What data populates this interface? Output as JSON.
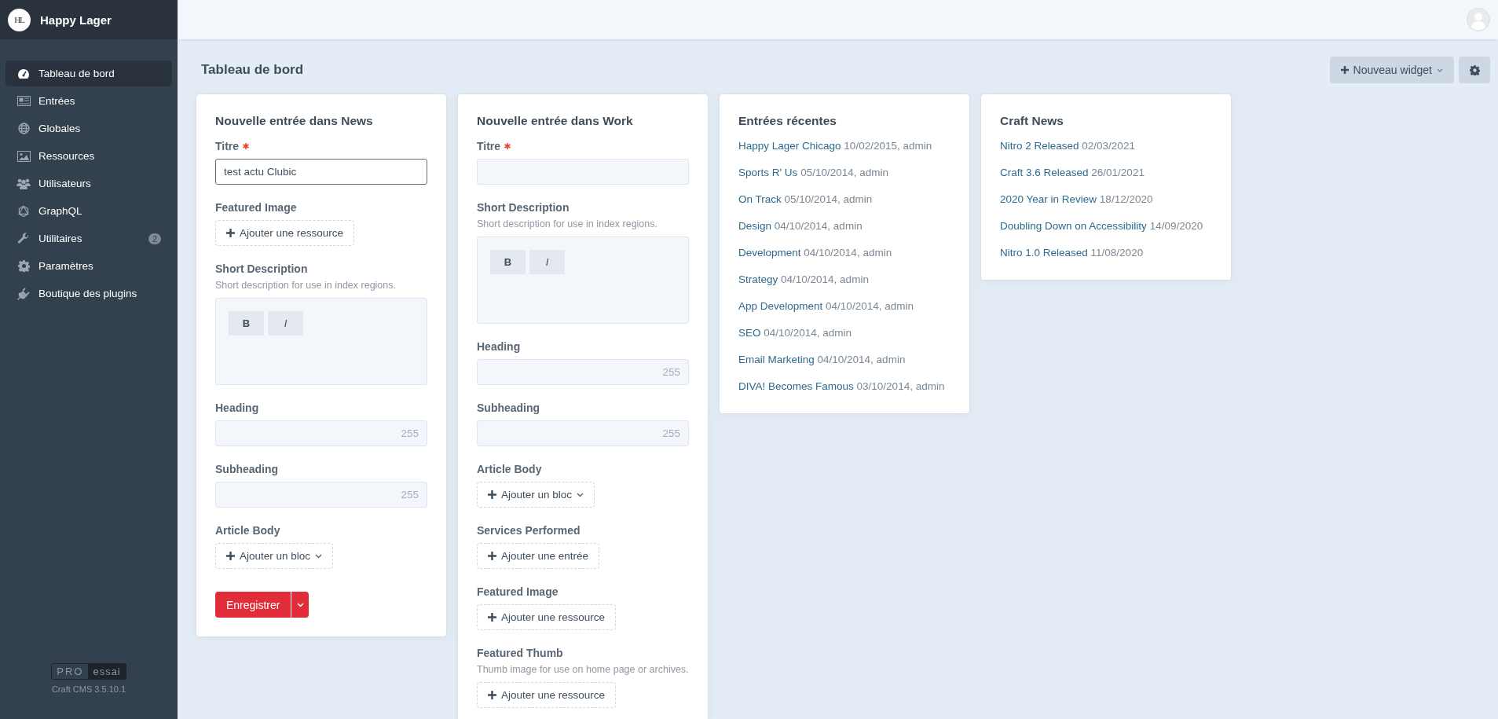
{
  "sidebar": {
    "logo_text": "HL",
    "site_name": "Happy Lager",
    "items": [
      {
        "label": "Tableau de bord",
        "selected": true
      },
      {
        "label": "Entrées",
        "selected": false
      },
      {
        "label": "Globales",
        "selected": false
      },
      {
        "label": "Ressources",
        "selected": false
      },
      {
        "label": "Utilisateurs",
        "selected": false
      },
      {
        "label": "GraphQL",
        "selected": false
      },
      {
        "label": "Utilitaires",
        "selected": false,
        "badge": "2"
      },
      {
        "label": "Paramètres",
        "selected": false
      },
      {
        "label": "Boutique des plugins",
        "selected": false
      }
    ],
    "edition": {
      "name": "PRO",
      "status": "essai"
    },
    "version": "Craft CMS 3.5.10.1"
  },
  "page_title": "Tableau de bord",
  "toolbar": {
    "new_widget": "Nouveau widget"
  },
  "widgets": [
    {
      "kind": "form",
      "title": "Nouvelle entrée dans News",
      "fields": [
        {
          "kind": "text",
          "label": "Titre",
          "required": true,
          "value": "test actu Clubic",
          "focused": true
        },
        {
          "kind": "button",
          "label": "Featured Image",
          "required": false,
          "button": "Ajouter une ressource",
          "caret": false
        },
        {
          "kind": "richtext",
          "label": "Short Description",
          "required": false,
          "instructions": "Short description for use in index regions.",
          "toolbar": [
            "B",
            "I"
          ]
        },
        {
          "kind": "text",
          "label": "Heading",
          "required": false,
          "counter": "255",
          "focused": false
        },
        {
          "kind": "text",
          "label": "Subheading",
          "required": false,
          "counter": "255",
          "focused": false
        },
        {
          "kind": "button",
          "label": "Article Body",
          "required": false,
          "button": "Ajouter un bloc",
          "caret": true
        }
      ],
      "save": "Enregistrer"
    },
    {
      "kind": "form",
      "title": "Nouvelle entrée dans Work",
      "fields": [
        {
          "kind": "text",
          "label": "Titre",
          "required": true,
          "focused": false
        },
        {
          "kind": "richtext",
          "label": "Short Description",
          "required": false,
          "instructions": "Short description for use in index regions.",
          "toolbar": [
            "B",
            "I"
          ]
        },
        {
          "kind": "text",
          "label": "Heading",
          "required": false,
          "counter": "255",
          "focused": false
        },
        {
          "kind": "text",
          "label": "Subheading",
          "required": false,
          "counter": "255",
          "focused": false
        },
        {
          "kind": "button",
          "label": "Article Body",
          "required": false,
          "button": "Ajouter un bloc",
          "caret": true
        },
        {
          "kind": "button",
          "label": "Services Performed",
          "required": false,
          "button": "Ajouter une entrée",
          "caret": false
        },
        {
          "kind": "button",
          "label": "Featured Image",
          "required": false,
          "button": "Ajouter une ressource",
          "caret": false
        },
        {
          "kind": "button",
          "label": "Featured Thumb",
          "required": false,
          "instructions": "Thumb image for use on home page or archives.",
          "button": "Ajouter une ressource",
          "caret": false
        }
      ]
    },
    {
      "kind": "list",
      "title": "Entrées récentes",
      "items": [
        {
          "link": "Happy Lager Chicago",
          "meta": "10/02/2015, admin"
        },
        {
          "link": "Sports R' Us",
          "meta": "05/10/2014, admin"
        },
        {
          "link": "On Track",
          "meta": "05/10/2014, admin"
        },
        {
          "link": "Design",
          "meta": "04/10/2014, admin"
        },
        {
          "link": "Development",
          "meta": "04/10/2014, admin"
        },
        {
          "link": "Strategy",
          "meta": "04/10/2014, admin"
        },
        {
          "link": "App Development",
          "meta": "04/10/2014, admin"
        },
        {
          "link": "SEO",
          "meta": "04/10/2014, admin"
        },
        {
          "link": "Email Marketing",
          "meta": "04/10/2014, admin"
        },
        {
          "link": "DIVA! Becomes Famous",
          "meta": "03/10/2014, admin"
        }
      ]
    },
    {
      "kind": "list",
      "title": "Craft News",
      "items": [
        {
          "link": "Nitro 2 Released",
          "meta": "02/03/2021"
        },
        {
          "link": "Craft 3.6 Released",
          "meta": "26/01/2021"
        },
        {
          "link": "2020 Year in Review",
          "meta": "18/12/2020"
        },
        {
          "link": "Doubling Down on Accessibility",
          "meta": "14/09/2020"
        },
        {
          "link": "Nitro 1.0 Released",
          "meta": "11/08/2020"
        }
      ]
    }
  ]
}
